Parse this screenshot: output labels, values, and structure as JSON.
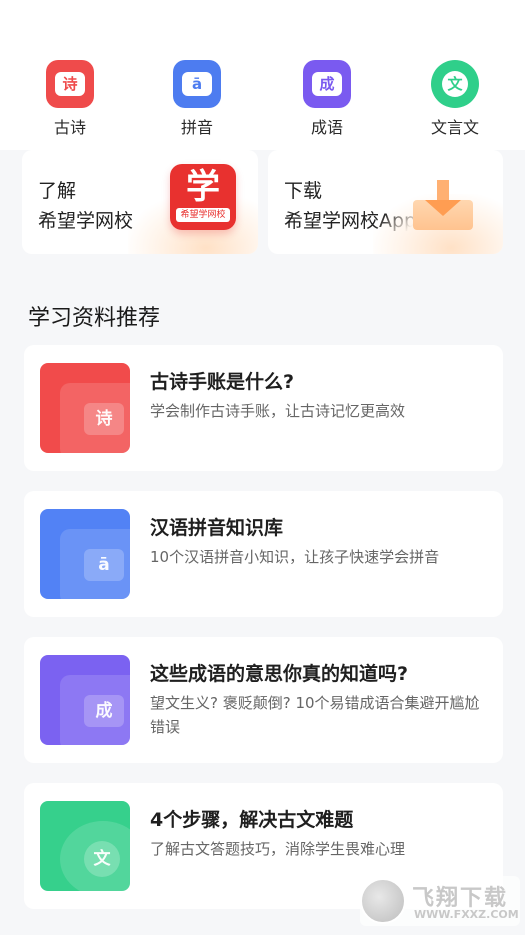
{
  "categories": [
    {
      "label": "古诗",
      "glyph": "诗",
      "color": "#ef4b4b",
      "icon": "poem-icon"
    },
    {
      "label": "拼音",
      "glyph": "ā",
      "color": "#4d7cf0",
      "icon": "pinyin-icon"
    },
    {
      "label": "成语",
      "glyph": "成",
      "color": "#7a5af0",
      "icon": "idiom-icon"
    },
    {
      "label": "文言文",
      "glyph": "文",
      "color": "#2fcf8a",
      "icon": "classical-icon"
    }
  ],
  "promos": [
    {
      "line1": "了解",
      "line2": "希望学网校",
      "logo_big": "学",
      "logo_small": "希望学网校"
    },
    {
      "line1": "下载",
      "line2": "希望学网校App"
    }
  ],
  "section_title": "学习资料推荐",
  "items": [
    {
      "title": "古诗手账是什么?",
      "desc": "学会制作古诗手账，让古诗记忆更高效",
      "glyph": "诗",
      "color": "#f14b4b",
      "icon": "poem-icon"
    },
    {
      "title": "汉语拼音知识库",
      "desc": "10个汉语拼音小知识，让孩子快速学会拼音",
      "glyph": "ā",
      "color": "#5282f5",
      "icon": "pinyin-icon"
    },
    {
      "title": "这些成语的意思你真的知道吗?",
      "desc": "望文生义? 褒贬颠倒? 10个易错成语合集避开尴尬错误",
      "glyph": "成",
      "color": "#7b62f1",
      "icon": "idiom-icon"
    },
    {
      "title": "4个步骤，解决古文难题",
      "desc": "了解古文答题技巧，消除学生畏难心理",
      "glyph": "文",
      "color": "#36d08c",
      "icon": "classical-icon"
    }
  ],
  "watermark": {
    "text": "飞翔下载",
    "url": "WWW.FXXZ.COM"
  }
}
